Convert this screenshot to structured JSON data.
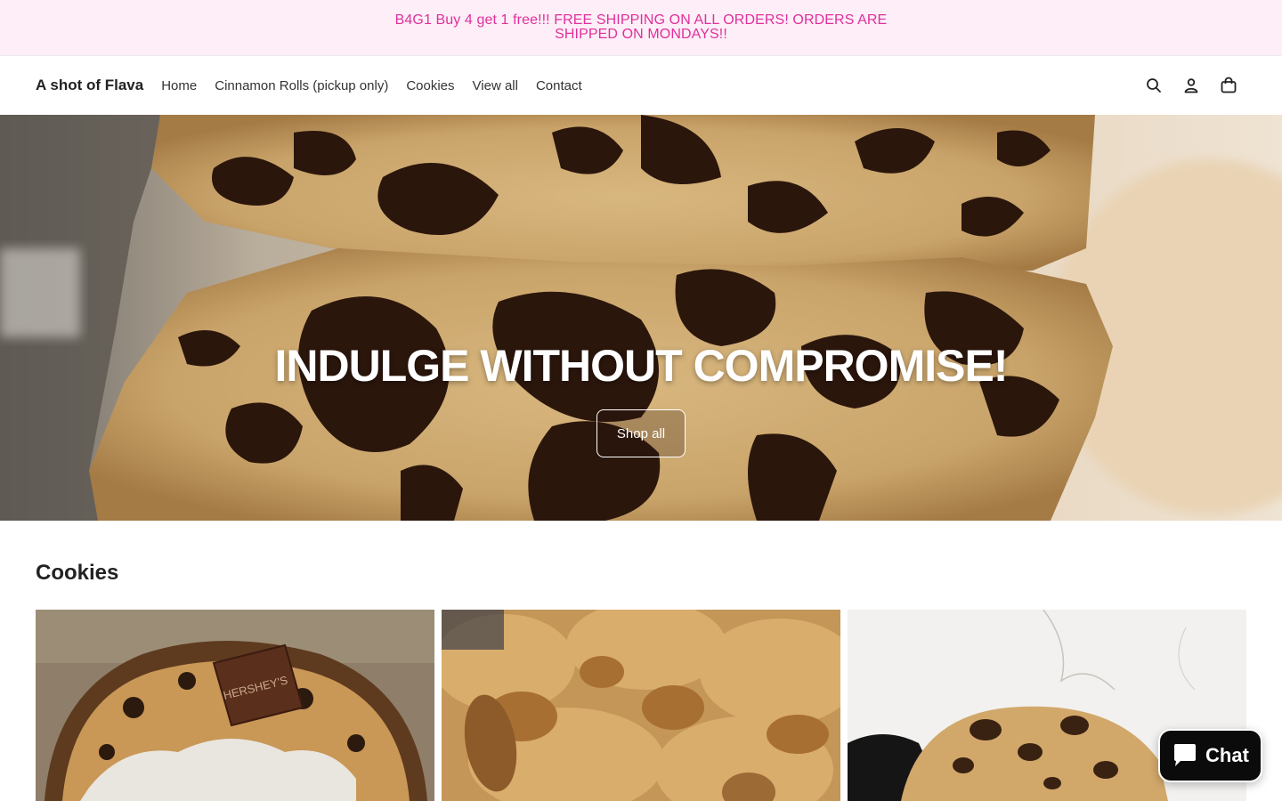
{
  "announcement": {
    "text": "B4G1 Buy 4 get 1 free!!! FREE SHIPPING ON ALL ORDERS! ORDERS ARE SHIPPED ON MONDAYS!!"
  },
  "header": {
    "brand": "A shot of Flava",
    "nav": [
      {
        "label": "Home"
      },
      {
        "label": "Cinnamon Rolls (pickup only)"
      },
      {
        "label": "Cookies"
      },
      {
        "label": "View all"
      },
      {
        "label": "Contact"
      }
    ],
    "icons": [
      "search-icon",
      "account-icon",
      "cart-icon"
    ]
  },
  "hero": {
    "title": "INDULGE WITHOUT COMPROMISE!",
    "button_label": "Shop all"
  },
  "collection": {
    "title": "Cookies",
    "products": [
      {
        "image": "smores-cookie-image"
      },
      {
        "image": "pecan-cookie-image"
      },
      {
        "image": "chocolate-chip-cookie-image"
      }
    ]
  },
  "chat": {
    "label": "Chat",
    "icon": "chat-bubble-icon"
  },
  "colors": {
    "announcement_bg": "#fdeef8",
    "announcement_text": "#e0309a",
    "chat_bg": "#0b0b0b"
  }
}
